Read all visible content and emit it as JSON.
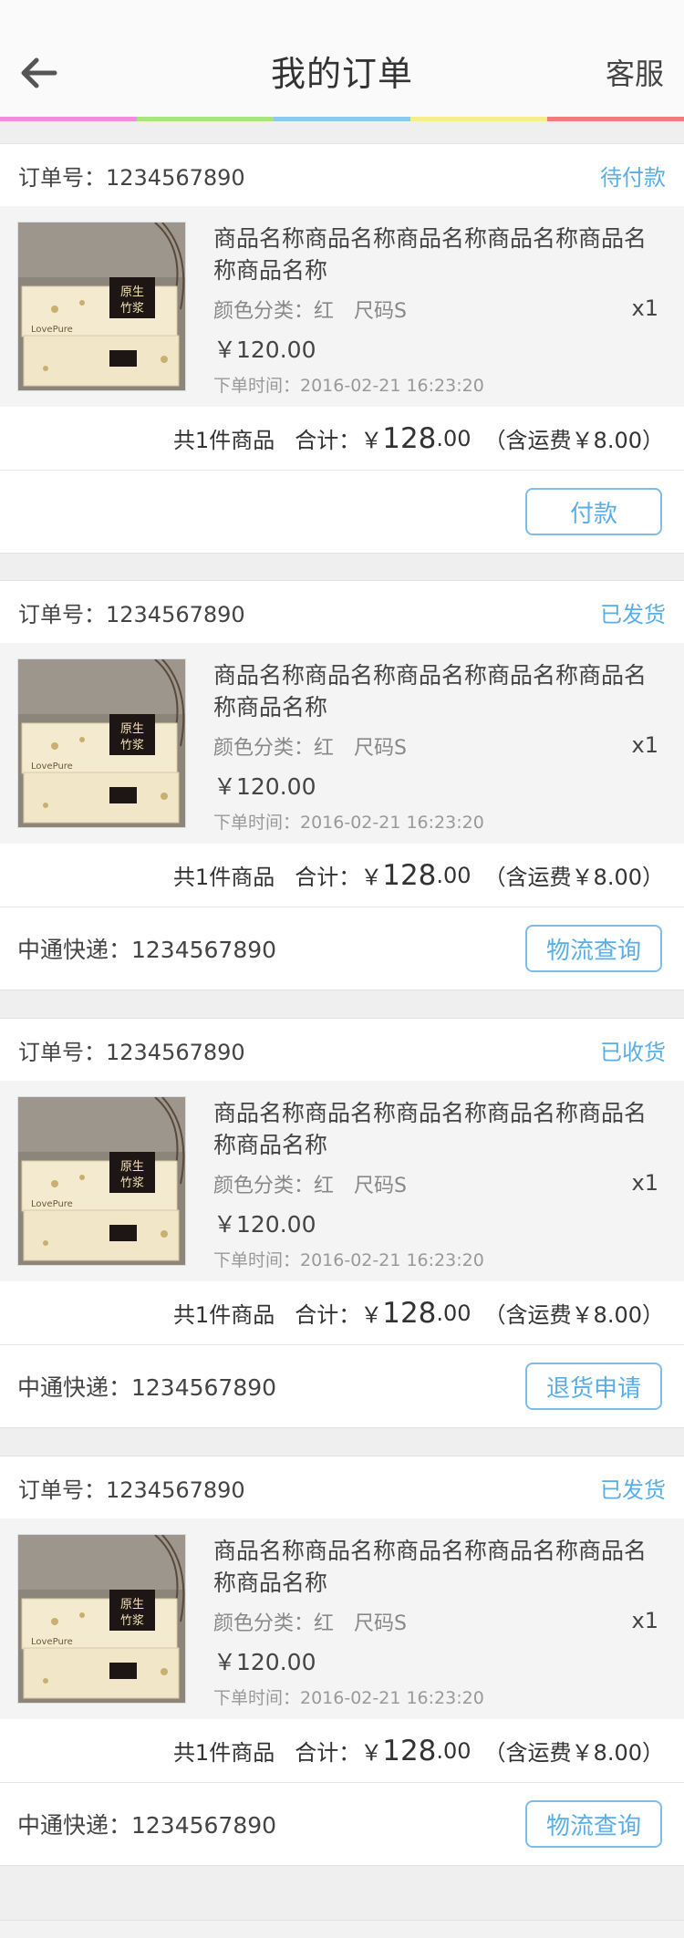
{
  "header": {
    "title": "我的订单",
    "service": "客服",
    "back_icon": "arrow-left-icon",
    "rainbow_colors": [
      "#f38ddb",
      "#a9e37d",
      "#8ec7f2",
      "#f4ef8a",
      "#f47b7b"
    ]
  },
  "colors": {
    "accent": "#5aaee6",
    "button_border": "#7fbde8",
    "background": "#efefef"
  },
  "orders": [
    {
      "order_label": "订单号：",
      "order_no": "1234567890",
      "status": "待付款",
      "product_name": "商品名称商品名称商品名称商品名称商品名称商品名称",
      "spec": "颜色分类：红　尺码S",
      "qty": "x1",
      "price": "￥120.00",
      "time": "下单时间：2016-02-21  16:23:20",
      "count_text": "共1件商品",
      "total_label": "合计：",
      "total_currency": "￥",
      "total_int": "128",
      "total_dec": ".00",
      "shipping": "（含运费￥8.00）",
      "courier": "",
      "action": "付款"
    },
    {
      "order_label": "订单号：",
      "order_no": "1234567890",
      "status": "已发货",
      "product_name": "商品名称商品名称商品名称商品名称商品名称商品名称",
      "spec": "颜色分类：红　尺码S",
      "qty": "x1",
      "price": "￥120.00",
      "time": "下单时间：2016-02-21  16:23:20",
      "count_text": "共1件商品",
      "total_label": "合计：",
      "total_currency": "￥",
      "total_int": "128",
      "total_dec": ".00",
      "shipping": "（含运费￥8.00）",
      "courier": "中通快递：1234567890",
      "action": "物流查询"
    },
    {
      "order_label": "订单号：",
      "order_no": "1234567890",
      "status": "已收货",
      "product_name": "商品名称商品名称商品名称商品名称商品名称商品名称",
      "spec": "颜色分类：红　尺码S",
      "qty": "x1",
      "price": "￥120.00",
      "time": "下单时间：2016-02-21  16:23:20",
      "count_text": "共1件商品",
      "total_label": "合计：",
      "total_currency": "￥",
      "total_int": "128",
      "total_dec": ".00",
      "shipping": "（含运费￥8.00）",
      "courier": "中通快递：1234567890",
      "action": "退货申请"
    },
    {
      "order_label": "订单号：",
      "order_no": "1234567890",
      "status": "已发货",
      "product_name": "商品名称商品名称商品名称商品名称商品名称商品名称",
      "spec": "颜色分类：红　尺码S",
      "qty": "x1",
      "price": "￥120.00",
      "time": "下单时间：2016-02-21  16:23:20",
      "count_text": "共1件商品",
      "total_label": "合计：",
      "total_currency": "￥",
      "total_int": "128",
      "total_dec": ".00",
      "shipping": "（含运费￥8.00）",
      "courier": "中通快递：1234567890",
      "action": "物流查询"
    }
  ],
  "product_image": {
    "label_top": "原生",
    "label_bottom": "竹浆",
    "brand": "LovePure",
    "icon": "tissue-pack-image"
  }
}
